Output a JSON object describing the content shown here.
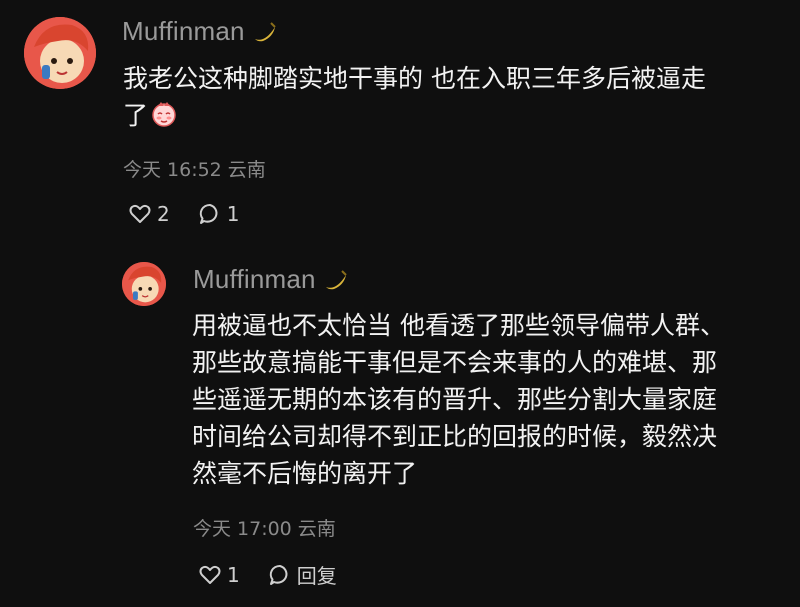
{
  "comment": {
    "username": "Muffinman",
    "text_line1": "我老公这种脚踏实地干事的 也在入职三年多后被逼走",
    "text_line2": "了",
    "date": "今天",
    "time": "16:52",
    "location": "云南",
    "likes": "2",
    "replies": "1"
  },
  "reply": {
    "username": "Muffinman",
    "lines": [
      "用被逼也不太恰当 他看透了那些领导偏带人群、",
      "那些故意搞能干事但是不会来事的人的难堪、那",
      "些遥遥无期的本该有的晋升、那些分割大量家庭",
      "时间给公司却得不到正比的回报的时候，毅然决",
      "然毫不后悔的离开了"
    ],
    "date": "今天",
    "time": "17:00",
    "location": "云南",
    "likes": "1",
    "reply_label": "回复"
  },
  "colors": {
    "background": "#0f0f0f",
    "username": "#9a9a9a",
    "meta": "#8a8a8a"
  },
  "icons": [
    "banana-badge-icon",
    "heart-icon",
    "speech-bubble-icon",
    "blush-emoji-icon"
  ]
}
